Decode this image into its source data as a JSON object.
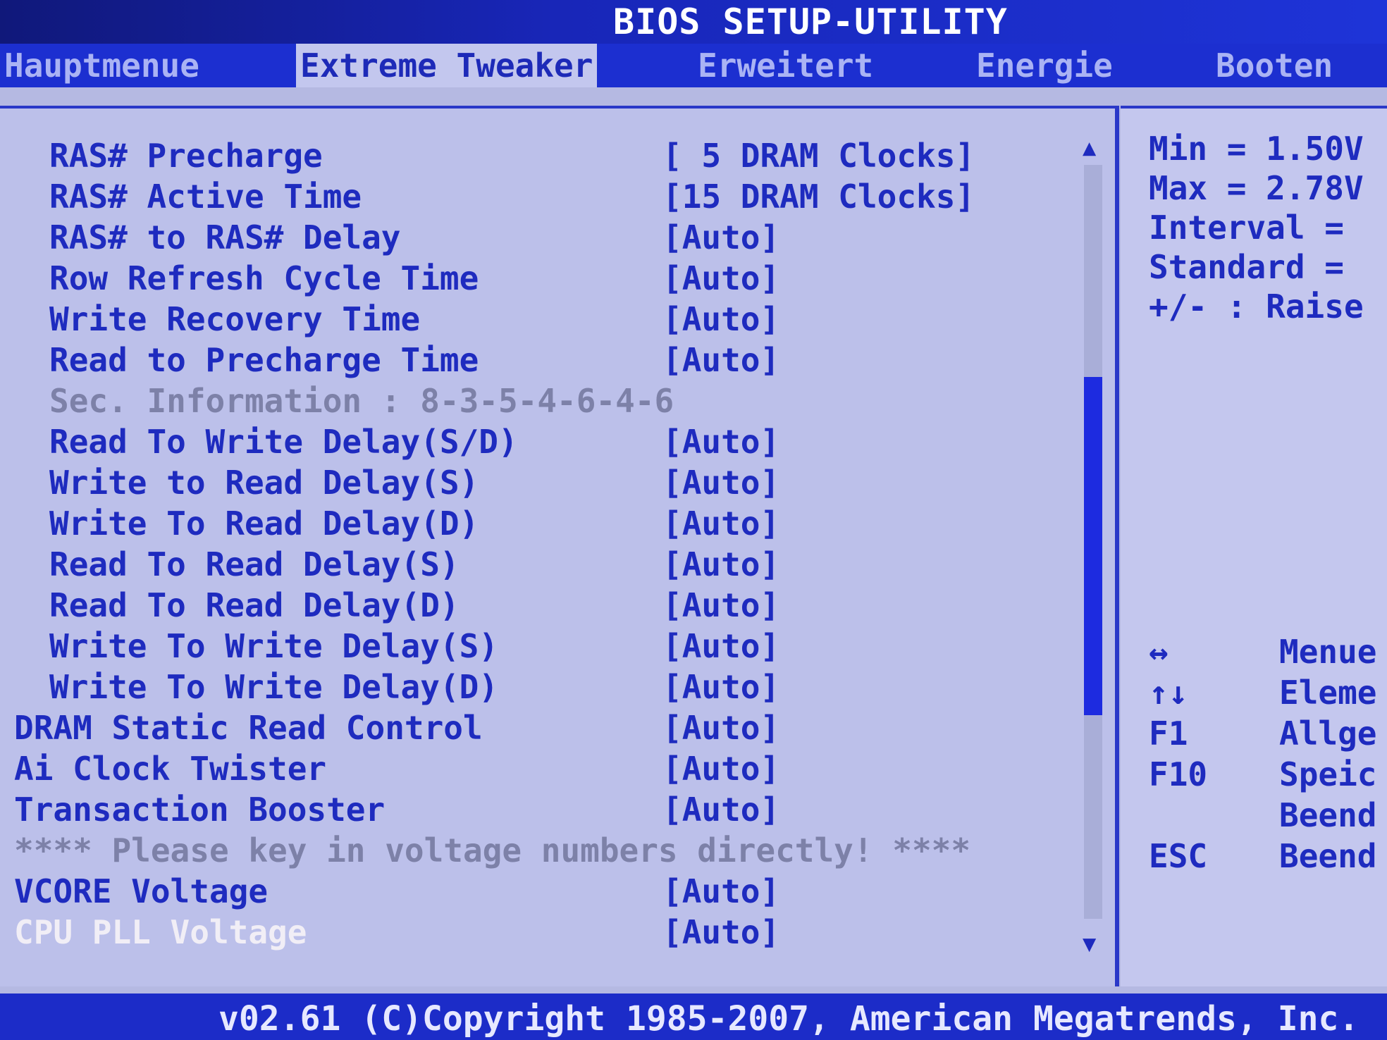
{
  "title": "BIOS SETUP-UTILITY",
  "tabs": [
    {
      "label": "Hauptmenue",
      "active": false
    },
    {
      "label": "Extreme Tweaker",
      "active": true
    },
    {
      "label": "Erweitert",
      "active": false
    },
    {
      "label": "Energie",
      "active": false
    },
    {
      "label": "Booten",
      "active": false
    }
  ],
  "menu": {
    "items": [
      {
        "label": "RAS# Precharge",
        "value": "[ 5 DRAM Clocks]"
      },
      {
        "label": "RAS# Active Time",
        "value": "[15 DRAM Clocks]"
      },
      {
        "label": "RAS# to RAS# Delay",
        "value": "[Auto]"
      },
      {
        "label": "Row Refresh Cycle Time",
        "value": "[Auto]"
      },
      {
        "label": "Write Recovery Time",
        "value": "[Auto]"
      },
      {
        "label": "Read to Precharge Time",
        "value": "[Auto]"
      },
      {
        "label": "Sec. Information : 8-3-5-4-6-4-6",
        "value": ""
      },
      {
        "label": "Read To Write Delay(S/D)",
        "value": "[Auto]"
      },
      {
        "label": "Write to Read Delay(S)",
        "value": "[Auto]"
      },
      {
        "label": "Write To Read Delay(D)",
        "value": "[Auto]"
      },
      {
        "label": "Read To Read Delay(S)",
        "value": "[Auto]"
      },
      {
        "label": "Read To Read Delay(D)",
        "value": "[Auto]"
      },
      {
        "label": "Write To Write Delay(S)",
        "value": "[Auto]"
      },
      {
        "label": "Write To Write Delay(D)",
        "value": "[Auto]"
      },
      {
        "label": "DRAM Static Read Control",
        "value": "[Auto]"
      },
      {
        "label": "Ai Clock Twister",
        "value": "[Auto]"
      },
      {
        "label": "Transaction Booster",
        "value": "[Auto]"
      },
      {
        "label": "**** Please key in voltage numbers directly! ****",
        "value": ""
      },
      {
        "label": "VCORE Voltage",
        "value": "[Auto]"
      },
      {
        "label": "CPU PLL Voltage",
        "value": "[Auto]"
      }
    ]
  },
  "help": {
    "lines": [
      "Min = 1.50V",
      "Max = 2.78V",
      "Interval =",
      "Standard =",
      "+/- : Raise"
    ]
  },
  "keys": [
    {
      "key": "↔",
      "desc": "Menue"
    },
    {
      "key": "↑↓",
      "desc": "Eleme"
    },
    {
      "key": "F1",
      "desc": "Allge"
    },
    {
      "key": "F10",
      "desc": "Speic"
    },
    {
      "key": "",
      "desc": "Beend"
    },
    {
      "key": "ESC",
      "desc": "Beend"
    }
  ],
  "scrollbar": {
    "up_glyph": "▲",
    "down_glyph": "▼"
  },
  "footer": "v02.61 (C)Copyright 1985-2007, American Megatrends, Inc."
}
